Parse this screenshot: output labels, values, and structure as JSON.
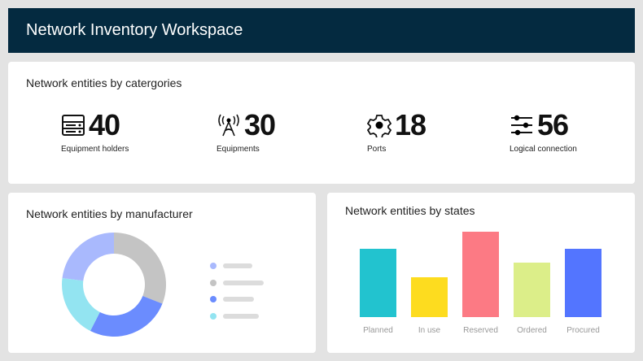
{
  "header": {
    "title": "Network Inventory Workspace"
  },
  "categories": {
    "title": "Network entities by catergories",
    "items": [
      {
        "icon": "server-rack-icon",
        "value": "40",
        "label": "Equipment holders"
      },
      {
        "icon": "antenna-icon",
        "value": "30",
        "label": "Equipments"
      },
      {
        "icon": "gear-icon",
        "value": "18",
        "label": "Ports"
      },
      {
        "icon": "sliders-icon",
        "value": "56",
        "label": "Logical connection"
      }
    ]
  },
  "chart_data": [
    {
      "type": "pie",
      "title": "Network entities by manufacturer",
      "donut": true,
      "slices": [
        {
          "value": 31,
          "color": "#c4c4c4"
        },
        {
          "value": 26.5,
          "color": "#6b8cfe"
        },
        {
          "value": 19.5,
          "color": "#93e4f1"
        },
        {
          "value": 23,
          "color": "#a9b9fd"
        }
      ],
      "legend": [
        {
          "color": "#a9b9fd"
        },
        {
          "color": "#c4c4c4"
        },
        {
          "color": "#6b8cfe"
        },
        {
          "color": "#93e4f1"
        }
      ]
    },
    {
      "type": "bar",
      "title": "Network entities by states",
      "categories": [
        "Planned",
        "In use",
        "Reserved",
        "Ordered",
        "Procured"
      ],
      "values": [
        84,
        49,
        105,
        67,
        84
      ],
      "colors": [
        "#22c3cf",
        "#fddc1f",
        "#fc7a84",
        "#dcee89",
        "#5375ff"
      ],
      "ylim": [
        0,
        105
      ]
    }
  ]
}
